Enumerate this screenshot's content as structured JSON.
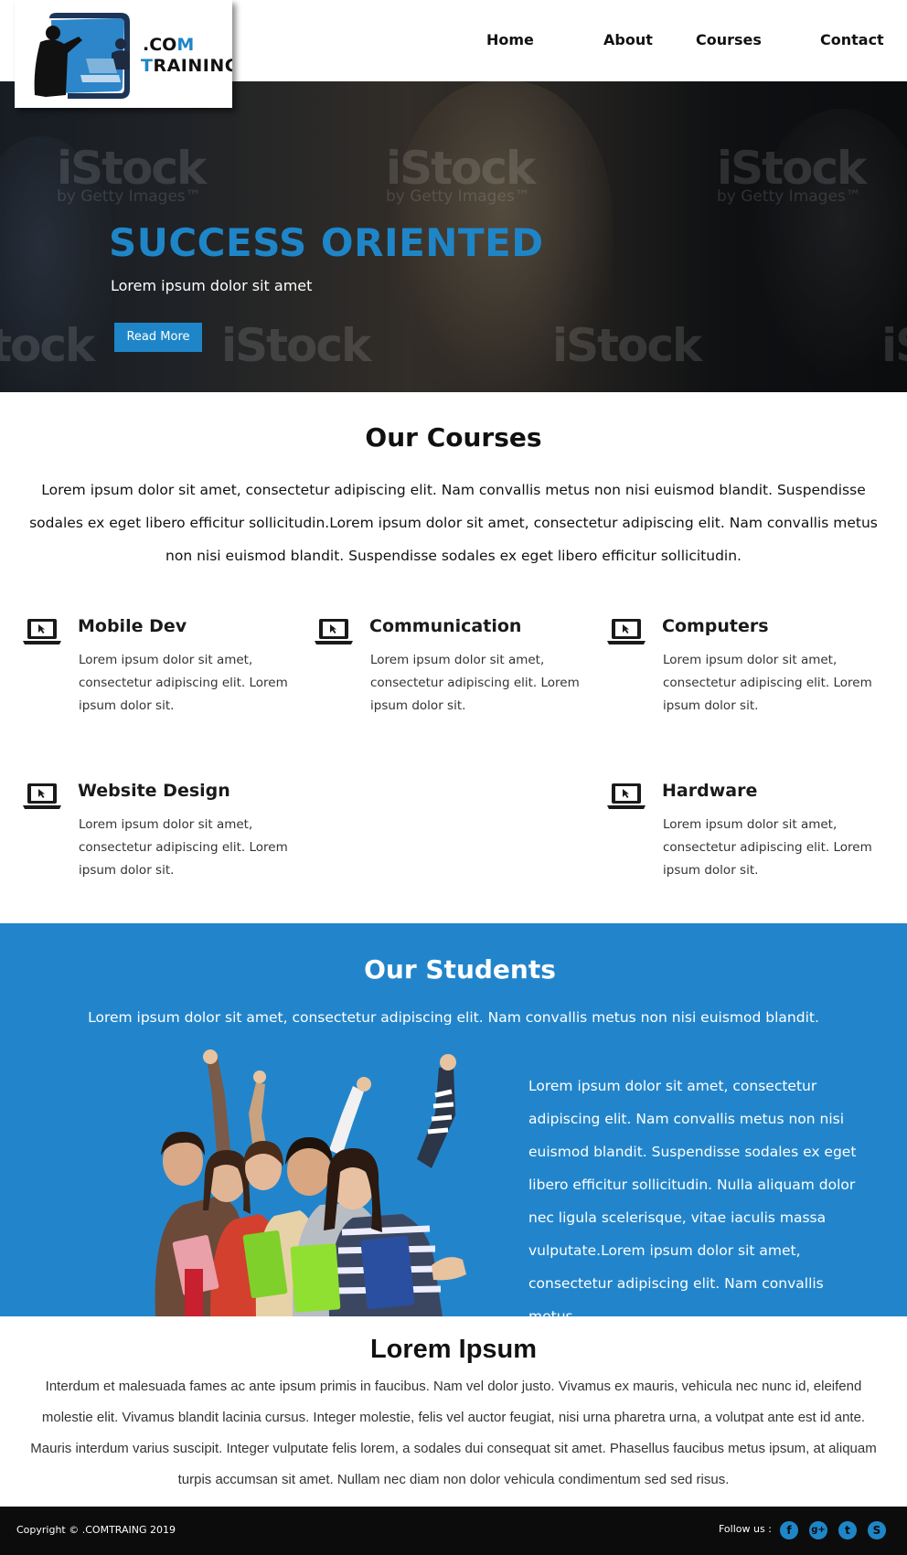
{
  "logo": {
    "dot_prefix": ".CO",
    "dot_m": "M",
    "training_t": "T",
    "training_rest": "RAINING"
  },
  "nav": [
    {
      "label": "Home"
    },
    {
      "label": "About"
    },
    {
      "label": "Courses"
    },
    {
      "label": "Contact"
    }
  ],
  "hero": {
    "title": "SUCCESS ORIENTED",
    "subtitle": "Lorem ipsum dolor sit amet",
    "button": "Read More",
    "watermark": "iStock",
    "watermark_sub": "by Getty Images™"
  },
  "courses": {
    "title": "Our Courses",
    "description": "Lorem ipsum dolor sit amet, consectetur adipiscing elit. Nam convallis metus non nisi euismod blandit. Suspendisse sodales ex eget libero efficitur sollicitudin.Lorem ipsum dolor sit amet, consectetur adipiscing elit. Nam convallis metus non nisi euismod blandit. Suspendisse sodales ex eget libero efficitur sollicitudin.",
    "items": [
      {
        "title": "Mobile Dev",
        "text": "Lorem ipsum dolor sit amet, consectetur adipiscing elit. Lorem ipsum dolor sit.",
        "icon": "laptop-icon"
      },
      {
        "title": "Communication",
        "text": "Lorem ipsum dolor sit amet, consectetur adipiscing elit. Lorem ipsum dolor sit.",
        "icon": "laptop-icon"
      },
      {
        "title": "Computers",
        "text": "Lorem ipsum dolor sit amet, consectetur adipiscing elit. Lorem ipsum dolor sit.",
        "icon": "laptop-icon"
      },
      {
        "title": "Website Design",
        "text": "Lorem ipsum dolor sit amet, consectetur adipiscing elit. Lorem ipsum dolor sit.",
        "icon": "laptop-icon"
      },
      {
        "title": "Hardware",
        "text": "Lorem ipsum dolor sit amet, consectetur adipiscing elit. Lorem ipsum dolor sit.",
        "icon": "laptop-icon"
      }
    ]
  },
  "students": {
    "title": "Our Students",
    "lead": "Lorem ipsum dolor sit amet, consectetur adipiscing elit. Nam convallis metus non nisi euismod blandit.",
    "paragraph": "Lorem ipsum dolor sit amet, consectetur adipiscing elit. Nam convallis metus non nisi euismod blandit. Suspendisse sodales ex eget libero efficitur sollicitudin. Nulla aliquam dolor nec ligula scelerisque, vitae iaculis massa vulputate.Lorem ipsum dolor sit amet, consectetur adipiscing elit. Nam convallis metus"
  },
  "lorem": {
    "title": "Lorem Ipsum",
    "text": "Interdum et malesuada fames ac ante ipsum primis in faucibus. Nam vel dolor justo. Vivamus ex mauris, vehicula nec nunc id, eleifend molestie elit. Vivamus blandit lacinia cursus. Integer molestie, felis vel auctor feugiat, nisi urna pharetra urna, a volutpat ante est id ante. Mauris interdum varius suscipit. Integer vulputate felis lorem, a sodales dui consequat sit amet. Phasellus faucibus metus ipsum, at aliquam turpis accumsan sit amet. Nullam nec diam non dolor vehicula condimentum sed sed risus."
  },
  "footer": {
    "copyright": "Copyright © .COMTRAING 2019",
    "follow": "Follow us :",
    "social": [
      {
        "icon": "facebook-icon",
        "glyph": "f"
      },
      {
        "icon": "google-plus-icon",
        "glyph": "g+"
      },
      {
        "icon": "twitter-icon",
        "glyph": "t"
      },
      {
        "icon": "skype-icon",
        "glyph": "S"
      }
    ]
  },
  "colors": {
    "accent": "#2285cb",
    "footer": "#0c0c0c"
  }
}
